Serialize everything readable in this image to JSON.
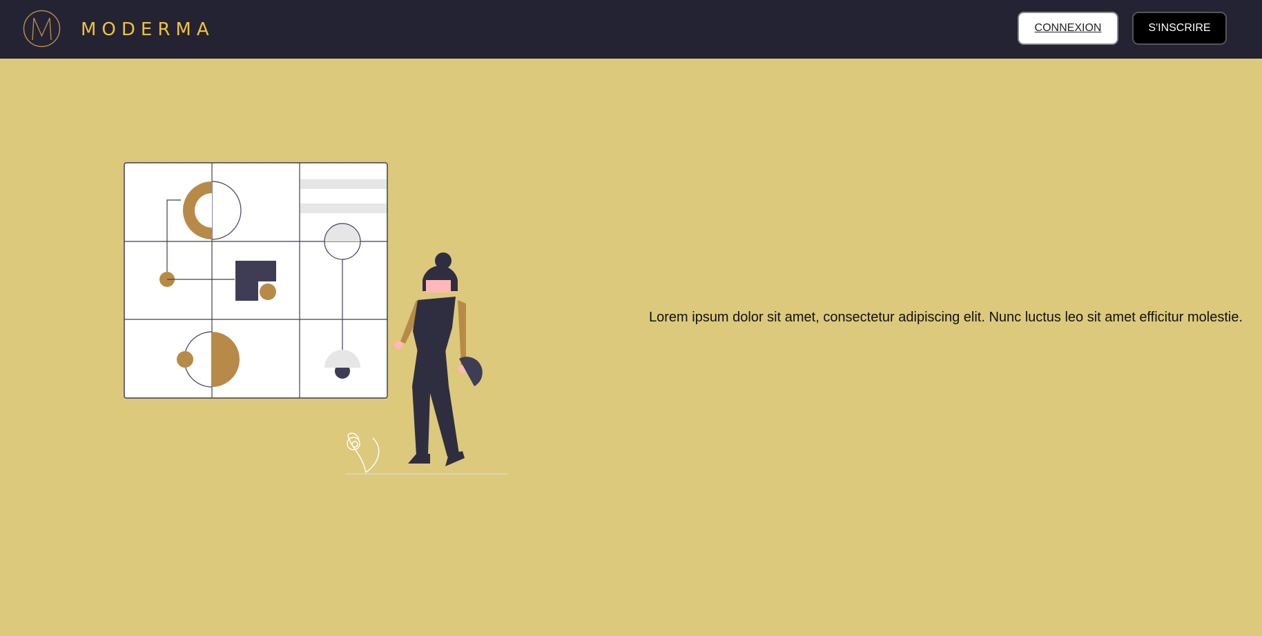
{
  "header": {
    "logo_icon": "m-circle-logo",
    "brand": "MODERMA",
    "login_label": "CONNEXION",
    "signup_label": "S'INSCRIRE"
  },
  "hero": {
    "text": "Lorem ipsum dolor sit amet, consectetur adipiscing elit. Nunc luctus leo sit amet efficitur molestie.",
    "illustration": "woman-with-geometric-art-board-illustration"
  },
  "colors": {
    "navbar": "#242333",
    "background": "#dcc97c",
    "brand": "#f0c23a",
    "accent": "#b88a47",
    "dark": "#3f3d56"
  }
}
